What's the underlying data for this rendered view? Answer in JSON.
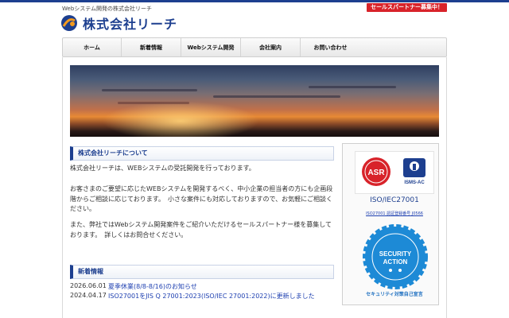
{
  "header": {
    "tagline": "Webシステム開発の株式会社リーチ",
    "partner_badge": "セールスパートナー募集中！",
    "logo_text": "株式会社リーチ"
  },
  "nav": {
    "items": [
      {
        "label": "ホーム"
      },
      {
        "label": "新着情報"
      },
      {
        "label": "Webシステム開発"
      },
      {
        "label": "会社案内"
      },
      {
        "label": "お問い合わせ"
      }
    ]
  },
  "about": {
    "heading": "株式会社リーチについて",
    "paragraphs": [
      "株式会社リーチは、WEBシステムの受託開発を行っております。",
      "お客さまのご要望に応じたWEBシステムを開発するべく、中小企業の担当者の方にも企画段階からご相談に応じております。　小さな案件にも対応しておりますので、お気軽にご相談ください。",
      "また、弊社ではWebシステム開発案件をご紹介いただけるセールスパートナー様を募集しております。　詳しくはお問合せください。"
    ]
  },
  "news": {
    "heading": "新着情報",
    "items": [
      {
        "date": "2026.06.01",
        "title": "夏季休業(8/8-8/16)のお知らせ"
      },
      {
        "date": "2024.04.17",
        "title": "ISO27001をJIS Q 27001:2023(ISO/IEC 27001:2022)に更新しました"
      }
    ]
  },
  "sidebar": {
    "iso_label": "ISO/IEC27001",
    "iso_link": "ISO27001 認証登録番号 J0566",
    "asr_text": "ASR",
    "isms_text": "ISMS-AC",
    "security_action_line1": "SECURITY",
    "security_action_line2": "ACTION",
    "security_caption": "セキュリティ対策自己宣言"
  },
  "colors": {
    "brand": "#1d3f8f",
    "badge_red": "#d8232a",
    "security_blue": "#1d8ad6"
  }
}
